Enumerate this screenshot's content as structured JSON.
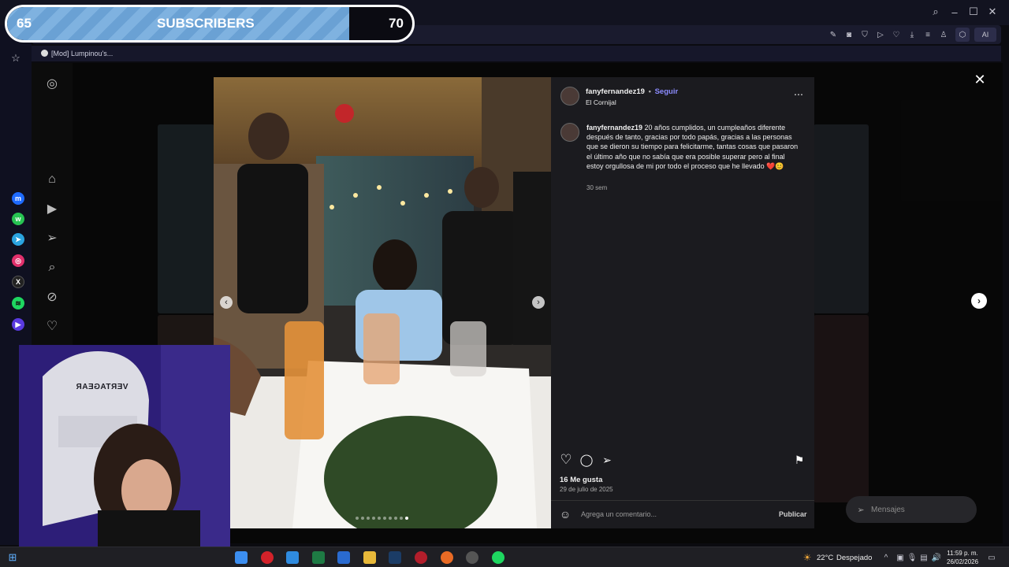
{
  "stream": {
    "sub_goal_current": "65",
    "sub_goal_label": "SUBSCRIBERS",
    "sub_goal_target": "70",
    "sub_goal_progress": 0.92,
    "chair_brand": "VERTAGEAR"
  },
  "browser": {
    "tab_title": "[Mod] Lumpinou's...",
    "ai_label": "AI"
  },
  "post": {
    "username": "fanyfernandez19",
    "separator": "•",
    "follow": "Seguir",
    "location": "El Cornijal",
    "caption_user": "fanyfernandez19",
    "caption_text": "20 años cumplidos, un cumpleaños diferente después de tanto, gracias por todo papás, gracias a las personas que se dieron su tiempo para felicitarme, tantas cosas que pasaron el último año que no sabía que era posible superar pero al final estoy orgullosa de mi por todo el proceso que he llevado",
    "caption_emojis": "❤️😊",
    "caption_age": "30 sem",
    "likes": "16 Me gusta",
    "date": "29 de julio de 2025",
    "comment_placeholder": "Agrega un comentario...",
    "publish": "Publicar",
    "messages": "Mensajes",
    "carousel_dots": 10,
    "carousel_active": 9
  },
  "taskbar": {
    "weather_temp": "22°C",
    "weather_desc": "Despejado",
    "time": "11:59 p. m.",
    "date": "26/02/2026"
  },
  "colors": {
    "accent_follow": "#8c8cff",
    "panel_bg": "#1b1b1f",
    "sub_bar_fill": "#7fb2e0"
  }
}
